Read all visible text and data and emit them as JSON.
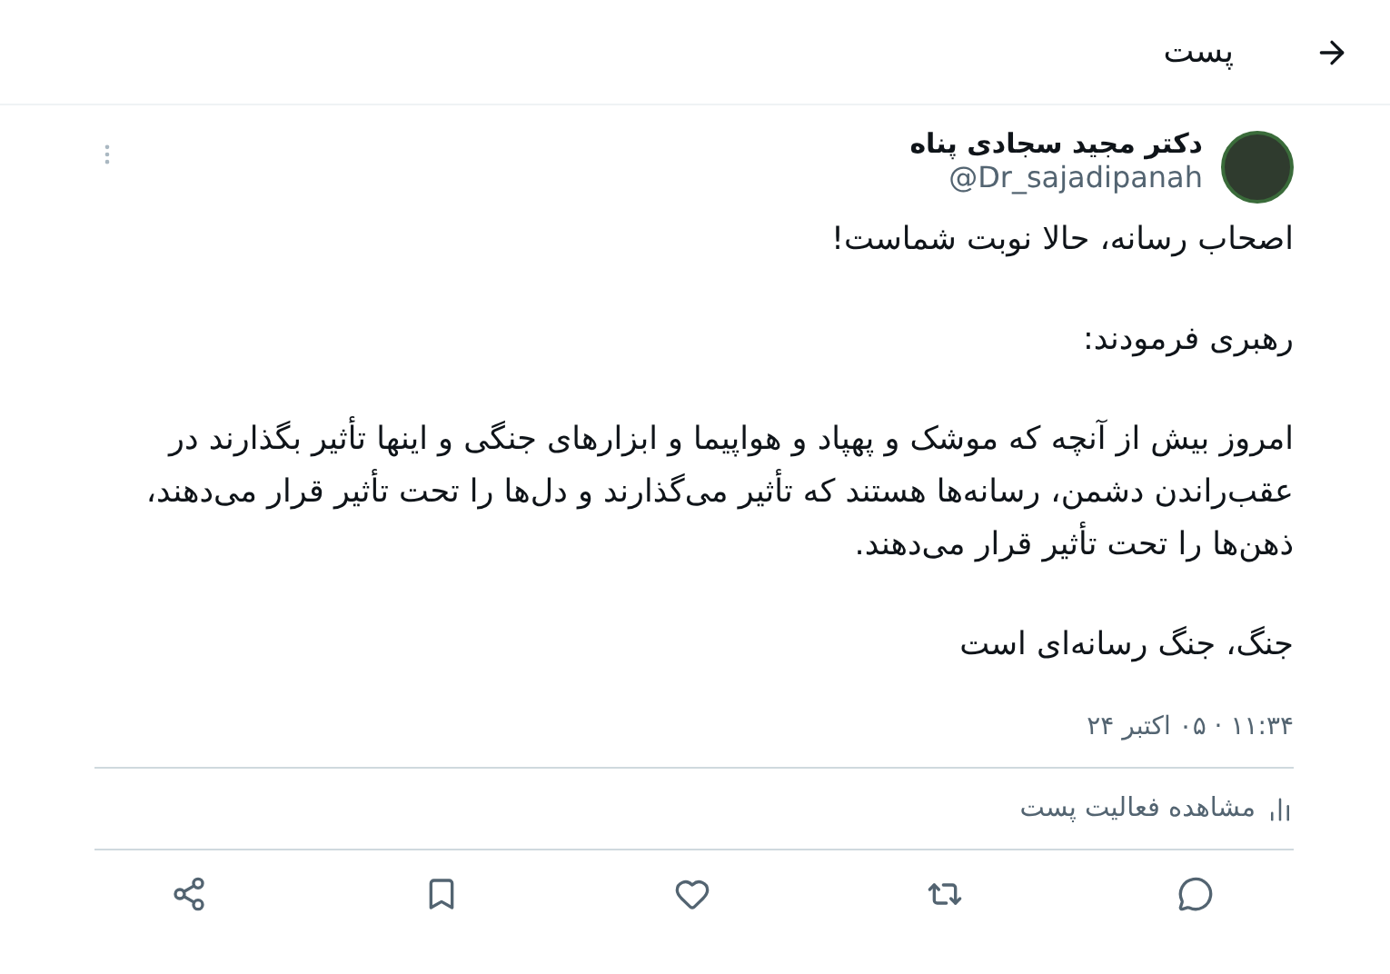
{
  "header": {
    "title": "پست"
  },
  "author": {
    "name": "دکتر مجید سجادی پناه",
    "handle": "@Dr_sajadipanah"
  },
  "paragraphs": [
    "اصحاب رسانه، حالا نوبت شماست!",
    "رهبری فرمودند:",
    "امروز بیش از آنچه که موشک و پهپاد و هواپیما و ابزارهای جنگی و اینها تأثیر بگذارند در عقب‌راندن دشمن، رسانه‌ها هستند که تأثیر می‌گذارند و دل‌ها را تحت تأثیر قرار می‌دهند، ذهن‌ها را تحت تأثیر قرار می‌دهند.",
    "جنگ، جنگ رسانه‌ای است"
  ],
  "timestamp": "۱۱:۳۴ · ۰۵ اکتبر ۲۴",
  "activity": {
    "label": "مشاهده فعالیت پست"
  },
  "actions": [
    {
      "kind": "reply"
    },
    {
      "kind": "repost"
    },
    {
      "kind": "like"
    },
    {
      "kind": "bookmark"
    },
    {
      "kind": "share"
    }
  ]
}
